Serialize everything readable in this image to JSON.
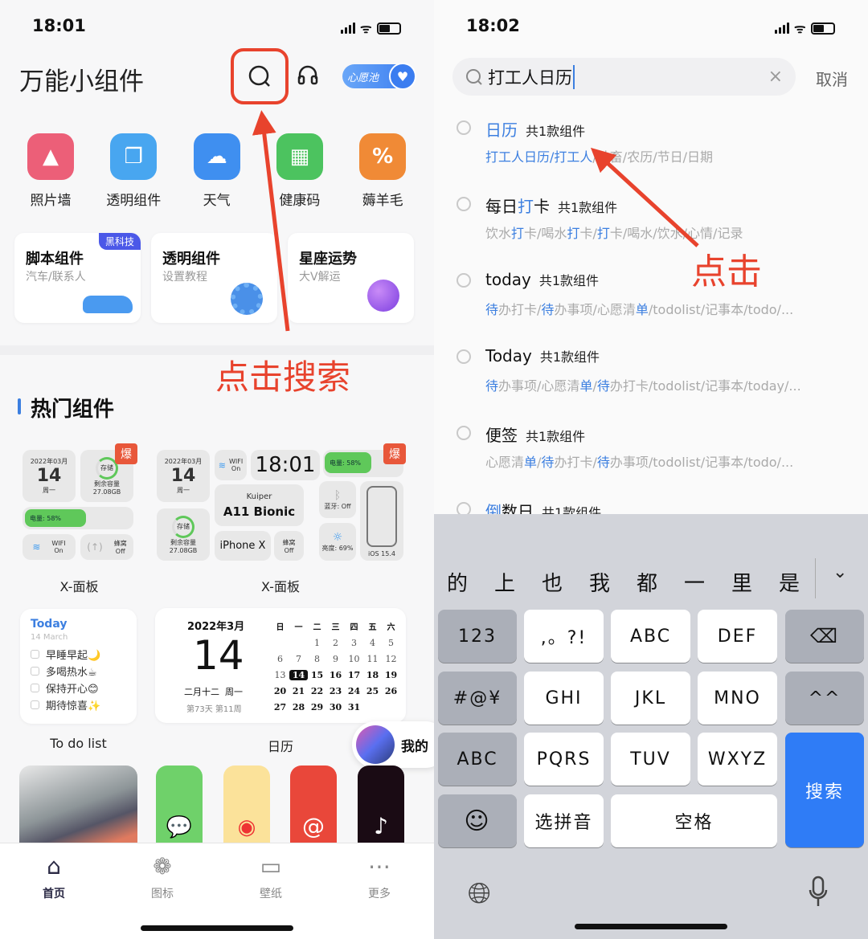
{
  "left": {
    "status_time": "18:01",
    "app_title": "万能小组件",
    "wish_pool_label": "心愿池",
    "quick_icons": [
      {
        "label": "照片墙",
        "icon": "photo-wall-icon",
        "color": "#ec5f78"
      },
      {
        "label": "透明组件",
        "icon": "transparent-widget-icon",
        "color": "#48a6f0"
      },
      {
        "label": "天气",
        "icon": "weather-icon",
        "color": "#3f8ff0"
      },
      {
        "label": "健康码",
        "icon": "health-code-icon",
        "color": "#4cc35f"
      },
      {
        "label": "薅羊毛",
        "icon": "coupon-icon",
        "color": "#f08a36"
      }
    ],
    "feature_cards": [
      {
        "title": "脚本组件",
        "subtitle": "汽车/联系人",
        "badge": "黑科技"
      },
      {
        "title": "透明组件",
        "subtitle": "设置教程"
      },
      {
        "title": "星座运势",
        "subtitle": "大V解运"
      }
    ],
    "annotation": "点击搜索",
    "section_title": "热门组件",
    "hot_badge": "爆",
    "xpanel_small": {
      "year_month": "2022年03月",
      "day": "14",
      "weekday": "周一",
      "storage": "存储",
      "remaining": "剩余容量",
      "capacity": "27.08GB",
      "battery": "电量: 58%",
      "battery_level": 58,
      "wifi": "WIFI",
      "wifi_state": "On",
      "cellular": "蜂窝",
      "cellular_state": "Off",
      "caption": "X-面板"
    },
    "xpanel_large": {
      "year_month": "2022年03月",
      "day": "14",
      "weekday": "周一",
      "storage": "存储",
      "remaining": "剩余容量",
      "capacity": "27.08GB",
      "wifi": "WIFI",
      "wifi_state": "On",
      "time": "18:01",
      "battery": "电量: 58%",
      "battery_level": 58,
      "device_name": "Kuiper",
      "chip": "A11 Bionic",
      "model": "iPhone X",
      "cellular": "蜂窝",
      "cellular_state": "Off",
      "bluetooth": "蓝牙: Off",
      "brightness": "亮度: 69%",
      "ios": "iOS 15.4",
      "caption": "X-面板"
    },
    "todo": {
      "title": "Today",
      "date": "14 March",
      "items": [
        "早睡早起🌙",
        "多喝热水☕",
        "保持开心😊",
        "期待惊喜✨"
      ],
      "caption": "To do list"
    },
    "calendar": {
      "year_month": "2022年3月",
      "day": "14",
      "lunar": "二月十二  周一",
      "day_of_year": "第73天 第11周",
      "weekdays": [
        "日",
        "一",
        "二",
        "三",
        "四",
        "五",
        "六"
      ],
      "first_weekday": 2,
      "days_in_month": 31,
      "today": 14,
      "caption": "日历"
    },
    "mine_label": "我的",
    "tabs": [
      {
        "label": "首页",
        "active": true
      },
      {
        "label": "图标"
      },
      {
        "label": "壁纸"
      },
      {
        "label": "更多"
      }
    ]
  },
  "right": {
    "status_time": "18:02",
    "search_value": "打工人日历",
    "cancel_label": "取消",
    "annotation": "点击",
    "results": [
      {
        "title": [
          {
            "t": "日历",
            "hl": true
          }
        ],
        "count": "共1款组件",
        "sub": [
          {
            "t": "打工人日历/打工人",
            "hl": true
          },
          {
            "t": "/社畜/农历/节日/日期"
          }
        ]
      },
      {
        "title": [
          {
            "t": "每日"
          },
          {
            "t": "打",
            "hl": true
          },
          {
            "t": "卡"
          }
        ],
        "count": "共1款组件",
        "sub": [
          {
            "t": "饮水"
          },
          {
            "t": "打",
            "hl": true
          },
          {
            "t": "卡/喝水"
          },
          {
            "t": "打",
            "hl": true
          },
          {
            "t": "卡/"
          },
          {
            "t": "打",
            "hl": true
          },
          {
            "t": "卡/喝水/饮水/心情/记录"
          }
        ]
      },
      {
        "title": [
          {
            "t": "today"
          }
        ],
        "count": "共1款组件",
        "sub": [
          {
            "t": "待",
            "hl": true
          },
          {
            "t": "办打卡/"
          },
          {
            "t": "待",
            "hl": true
          },
          {
            "t": "办事项/心愿清"
          },
          {
            "t": "单",
            "hl": true
          },
          {
            "t": "/todolist/记事本/todo/..."
          }
        ]
      },
      {
        "title": [
          {
            "t": "Today"
          }
        ],
        "count": "共1款组件",
        "sub": [
          {
            "t": "待",
            "hl": true
          },
          {
            "t": "办事项/心愿清"
          },
          {
            "t": "单",
            "hl": true
          },
          {
            "t": "/"
          },
          {
            "t": "待",
            "hl": true
          },
          {
            "t": "办打卡/todolist/记事本/today/..."
          }
        ]
      },
      {
        "title": [
          {
            "t": "便签"
          }
        ],
        "count": "共1款组件",
        "sub": [
          {
            "t": "心愿清"
          },
          {
            "t": "单",
            "hl": true
          },
          {
            "t": "/"
          },
          {
            "t": "待",
            "hl": true
          },
          {
            "t": "办打卡/"
          },
          {
            "t": "待",
            "hl": true
          },
          {
            "t": "办事项/todolist/记事本/todo/..."
          }
        ]
      },
      {
        "title": [
          {
            "t": "倒",
            "hl": true
          },
          {
            "t": "数日"
          }
        ],
        "count": "共1款组件",
        "sub": []
      }
    ],
    "candidates": [
      "的",
      "上",
      "也",
      "我",
      "都",
      "一",
      "里",
      "是"
    ],
    "keys": {
      "num": "123",
      "punct": ",。?!",
      "abc_key": "ABC",
      "def": "DEF",
      "sym": "#@¥",
      "ghi": "GHI",
      "jkl": "JKL",
      "mno": "MNO",
      "caret": "^^",
      "abc": "ABC",
      "pqrs": "PQRS",
      "tuv": "TUV",
      "wxyz": "WXYZ",
      "search": "搜索",
      "pinyin": "选拼音",
      "space": "空格"
    }
  },
  "colors": {
    "accent_red": "#e8432d",
    "blue": "#3c7fe0",
    "key_blue": "#2f7cf6"
  }
}
